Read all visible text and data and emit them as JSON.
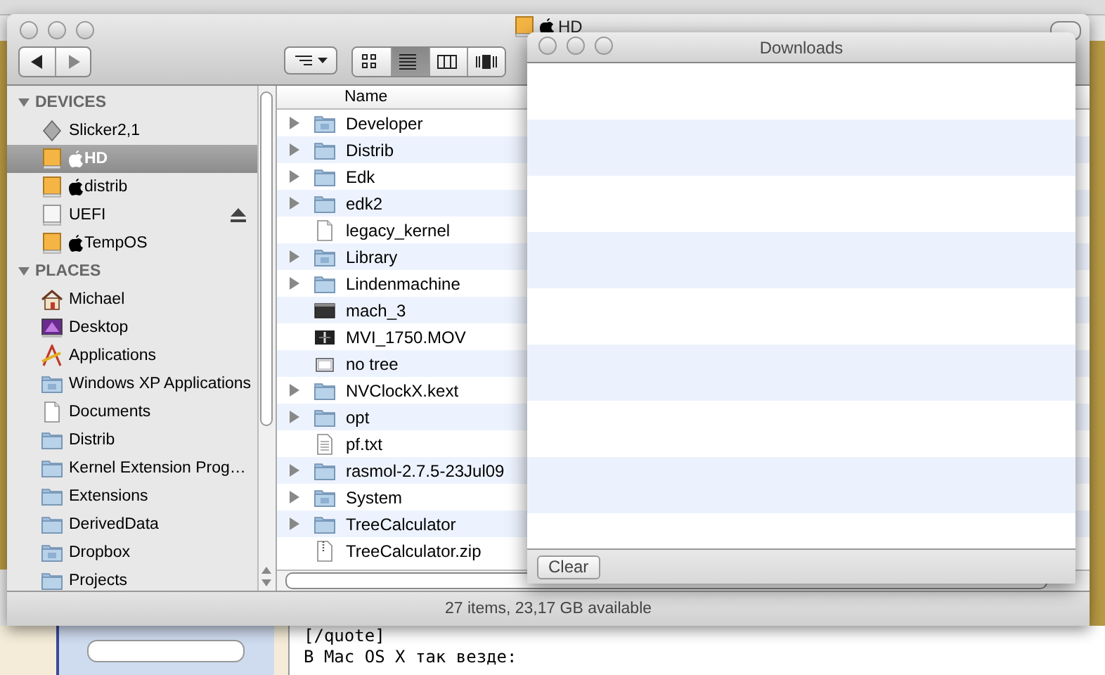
{
  "forum": {
    "lines": [
      "[/quote]",
      "В Mac OS X так везде:"
    ]
  },
  "finder": {
    "title": "HD",
    "title_system": true,
    "views": [
      {
        "kind": "icons",
        "selected": false
      },
      {
        "kind": "list",
        "selected": true
      },
      {
        "kind": "columns",
        "selected": false
      },
      {
        "kind": "coverflow",
        "selected": false
      }
    ],
    "sidebar": [
      {
        "title": "DEVICES",
        "expanded": true,
        "items": [
          {
            "label": "Slicker2,1",
            "kind": "network",
            "system": false,
            "selected": false
          },
          {
            "label": "HD",
            "kind": "drive",
            "system": true,
            "selected": true
          },
          {
            "label": "distrib",
            "kind": "drive",
            "system": true,
            "selected": false
          },
          {
            "label": "UEFI",
            "kind": "removable",
            "system": false,
            "selected": false
          },
          {
            "label": "TempOS",
            "kind": "drive",
            "system": true,
            "selected": false
          }
        ]
      },
      {
        "title": "PLACES",
        "expanded": true,
        "items": [
          {
            "label": "Michael",
            "kind": "home",
            "system": false,
            "selected": false
          },
          {
            "label": "Desktop",
            "kind": "desktop",
            "system": false,
            "selected": false
          },
          {
            "label": "Applications",
            "kind": "apps",
            "system": false,
            "selected": false
          },
          {
            "label": "Windows XP Applications",
            "kind": "special-folder",
            "system": false,
            "selected": false
          },
          {
            "label": "Documents",
            "kind": "document",
            "system": false,
            "selected": false
          },
          {
            "label": "Distrib",
            "kind": "folder",
            "system": false,
            "selected": false
          },
          {
            "label": "Kernel Extension Prog…",
            "kind": "folder",
            "system": false,
            "selected": false
          },
          {
            "label": "Extensions",
            "kind": "folder",
            "system": false,
            "selected": false
          },
          {
            "label": "DerivedData",
            "kind": "folder",
            "system": false,
            "selected": false
          },
          {
            "label": "Dropbox",
            "kind": "special-folder",
            "system": false,
            "selected": false
          },
          {
            "label": "Projects",
            "kind": "folder",
            "system": false,
            "selected": false
          }
        ]
      }
    ],
    "columns": [
      "Name"
    ],
    "rows": [
      {
        "name": "Developer",
        "kind": "special-folder",
        "selected": false
      },
      {
        "name": "Distrib",
        "kind": "folder",
        "selected": false
      },
      {
        "name": "Edk",
        "kind": "folder",
        "selected": false
      },
      {
        "name": "edk2",
        "kind": "folder",
        "selected": false
      },
      {
        "name": "legacy_kernel",
        "kind": "document",
        "selected": false
      },
      {
        "name": "Library",
        "kind": "special-folder",
        "selected": false
      },
      {
        "name": "Lindenmachine",
        "kind": "folder",
        "selected": false
      },
      {
        "name": "mach_3",
        "kind": "terminal",
        "selected": false
      },
      {
        "name": "MVI_1750.MOV",
        "kind": "movie",
        "selected": false
      },
      {
        "name": "no tree",
        "kind": "window",
        "selected": false
      },
      {
        "name": "NVClockX.kext",
        "kind": "folder",
        "selected": false
      },
      {
        "name": "opt",
        "kind": "folder",
        "selected": false
      },
      {
        "name": "pf.txt",
        "kind": "text",
        "selected": false
      },
      {
        "name": "rasmol-2.7.5-23Jul09",
        "kind": "folder",
        "selected": false
      },
      {
        "name": "System",
        "kind": "special-folder",
        "selected": false
      },
      {
        "name": "TreeCalculator",
        "kind": "folder",
        "selected": false
      },
      {
        "name": "TreeCalculator.zip",
        "kind": "archive",
        "selected": false
      }
    ],
    "status": "27 items, 23,17 GB available"
  },
  "downloads": {
    "title": "Downloads",
    "button": "Clear"
  }
}
